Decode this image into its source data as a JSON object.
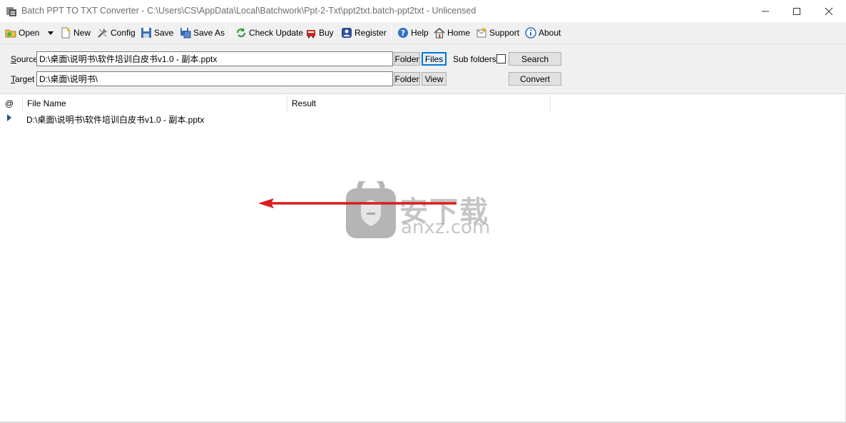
{
  "window": {
    "title": "Batch PPT TO TXT Converter - C:\\Users\\CS\\AppData\\Local\\Batchwork\\Ppt-2-Txt\\ppt2txt.batch-ppt2txt - Unlicensed"
  },
  "toolbar": {
    "open": "Open",
    "new": "New",
    "config": "Config",
    "save": "Save",
    "save_as": "Save As",
    "check_update": "Check Update",
    "buy": "Buy",
    "register": "Register",
    "help": "Help",
    "home": "Home",
    "support": "Support",
    "about": "About"
  },
  "paths": {
    "source_label_accel": "S",
    "source_label_rest": "ource",
    "source_value": "D:\\桌面\\说明书\\软件培训白皮书v1.0 - 副本.pptx",
    "target_label_accel": "T",
    "target_label_rest": "arget",
    "target_value": "D:\\桌面\\说明书\\",
    "folder_btn": "Folder",
    "files_btn": "Files",
    "view_btn": "View",
    "subfolders_label": "Sub folders",
    "subfolders_checked": false,
    "search_btn": "Search",
    "convert_btn": "Convert"
  },
  "list": {
    "columns": [
      "@",
      "File Name",
      "Result"
    ],
    "rows": [
      {
        "file": "D:\\桌面\\说明书\\软件培训白皮书v1.0 - 副本.pptx",
        "result": ""
      }
    ]
  },
  "watermark": {
    "cn": "安下载",
    "en": "anxz.com"
  },
  "colors": {
    "toolbar_bg": "#f0f0f0",
    "arrow": "#d81e1e",
    "focus": "#0078d7"
  }
}
